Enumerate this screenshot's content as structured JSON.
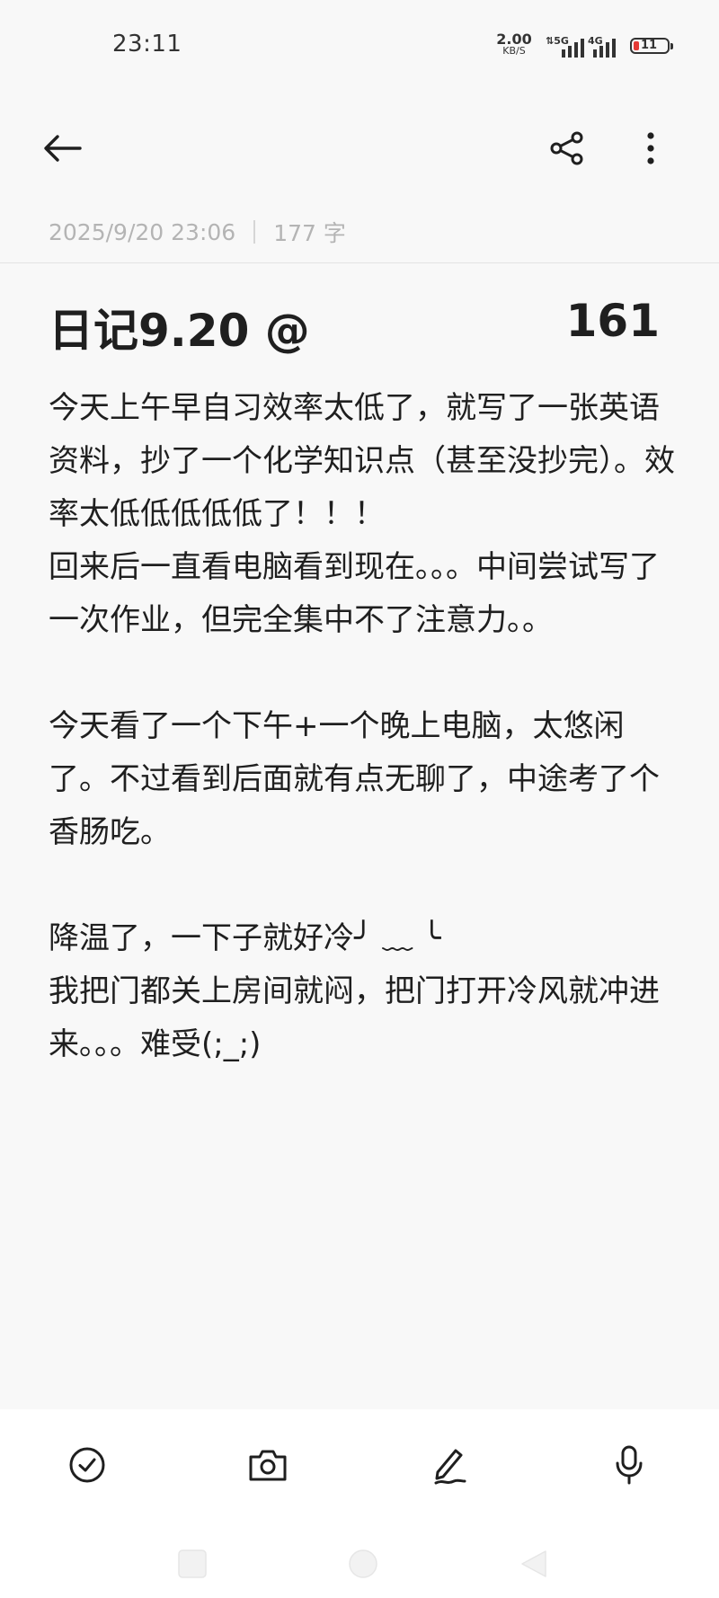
{
  "status_bar": {
    "time": "23:11",
    "net_speed_value": "2.00",
    "net_speed_unit": "KB/S",
    "signal1_label": "5G",
    "signal2_label": "4G",
    "battery_level": "11",
    "battery_color": "#e53935"
  },
  "toolbar": {
    "back_icon": "arrow-left-icon",
    "share_icon": "share-icon",
    "more_icon": "more-vertical-icon"
  },
  "note": {
    "date": "2025/9/20 23:06",
    "word_count": "177 字",
    "title": "日记9.20 @",
    "title_number": "161",
    "body": "今天上午早自习效率太低了，就写了一张英语资料，抄了一个化学知识点（甚至没抄完）。效率太低低低低低了！！！\n回来后一直看电脑看到现在。。。中间尝试写了一次作业，但完全集中不了注意力。。\n\n今天看了一个下午+一个晚上电脑，太悠闲了。不过看到后面就有点无聊了，中途考了个香肠吃。\n\n降温了，一下子就好冷╯ ﹏ ╰\n我把门都关上房间就闷，把门打开冷风就冲进来。。。难受(;_;)"
  },
  "bottom_bar": {
    "items": [
      "checklist-icon",
      "camera-icon",
      "handwriting-icon",
      "microphone-icon"
    ]
  },
  "nav_bar": {
    "items": [
      "recent-apps-icon",
      "home-icon",
      "back-nav-icon"
    ]
  }
}
